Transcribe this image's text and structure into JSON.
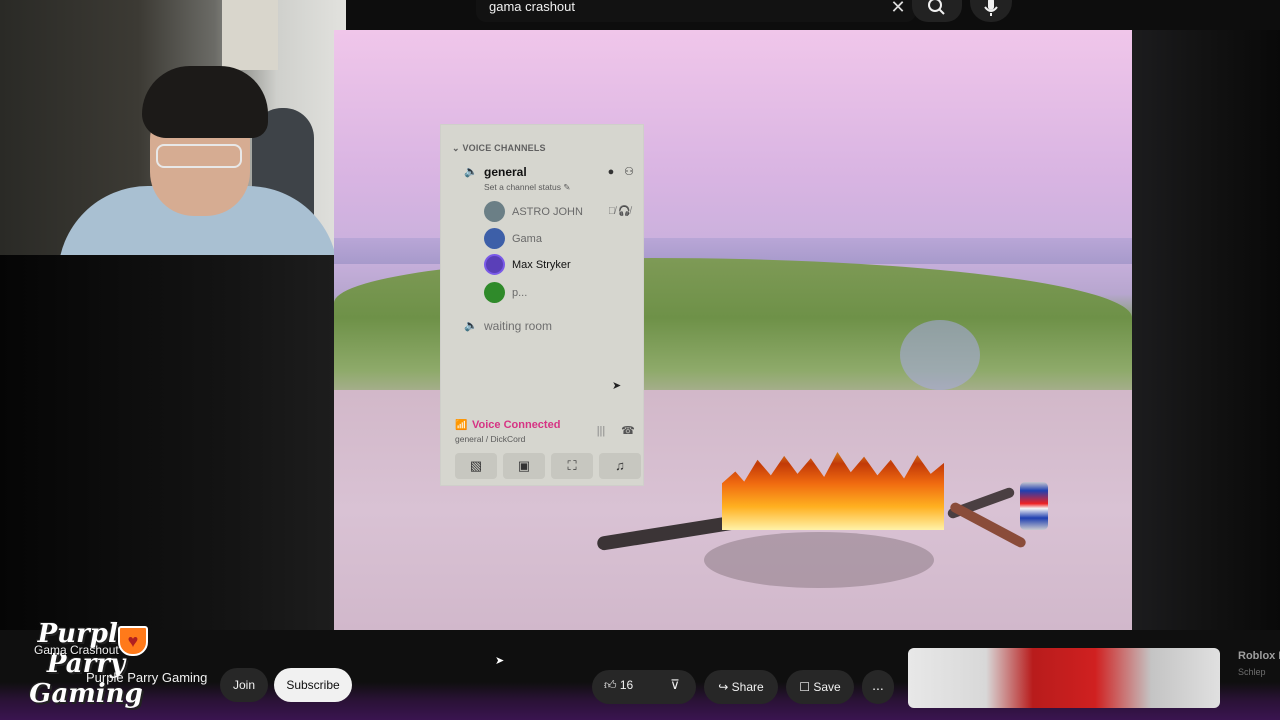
{
  "search": {
    "query": "gama crashout"
  },
  "discord": {
    "section_title": "VOICE CHANNELS",
    "channels": [
      {
        "name": "general",
        "status": "Set a channel status"
      },
      {
        "name": "waiting room"
      }
    ],
    "members": [
      {
        "name": "ASTRO JOHN",
        "avatar_color": "#6b7f86"
      },
      {
        "name": "Gama",
        "avatar_color": "#3d5fa8"
      },
      {
        "name": "Max Stryker",
        "avatar_color": "#5a3fb8"
      },
      {
        "name": "p...",
        "avatar_color": "#2f8a2a"
      }
    ],
    "voice": {
      "title": "Voice Connected",
      "subtitle": "general / DickCord",
      "accent": "#d63384"
    }
  },
  "overlay": {
    "logo_lines": [
      "Purple",
      "Parry",
      "Gaming"
    ],
    "label": "Gama Crashout"
  },
  "player": {
    "channel_name": "Purple Parry Gaming",
    "join_label": "Join",
    "subscribe_label": "Subscribe",
    "likes": "16",
    "share_label": "Share",
    "save_label": "Save",
    "more_label": "...",
    "recommended": {
      "title": "Roblox I",
      "channel": "Schlep"
    }
  }
}
